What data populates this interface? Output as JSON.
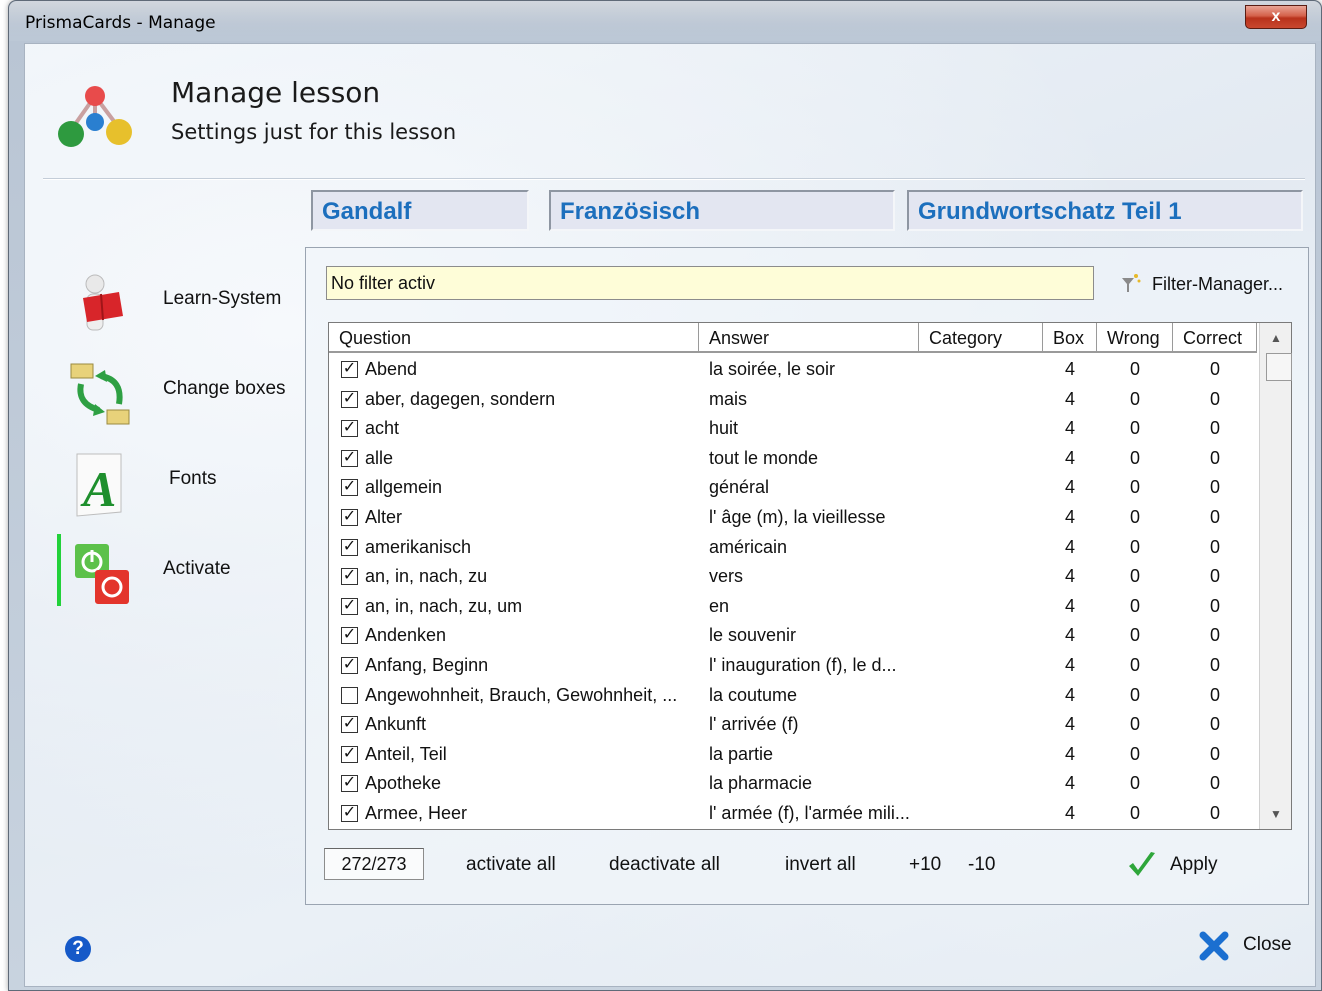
{
  "window": {
    "title": "PrismaCards - Manage",
    "close_glyph": "x"
  },
  "header": {
    "title": "Manage lesson",
    "subtitle": "Settings just for this lesson"
  },
  "info": {
    "user": "Gandalf",
    "language": "Französisch",
    "lesson": "Grundwortschatz Teil 1"
  },
  "sidebar": {
    "items": [
      {
        "label": "Learn-System",
        "icon": "learn-system-icon"
      },
      {
        "label": "Change boxes",
        "icon": "change-boxes-icon"
      },
      {
        "label": "Fonts",
        "icon": "fonts-icon"
      },
      {
        "label": "Activate",
        "icon": "activate-icon",
        "active": true
      }
    ]
  },
  "filter": {
    "value": "No filter activ",
    "manager_label": "Filter-Manager..."
  },
  "grid": {
    "columns": [
      "Question",
      "Answer",
      "Category",
      "Box",
      "Wrong",
      "Correct"
    ],
    "rows": [
      {
        "checked": true,
        "question": "Abend",
        "answer": "la soirée, le soir",
        "category": "",
        "box": "4",
        "wrong": "0",
        "correct": "0"
      },
      {
        "checked": true,
        "question": "aber, dagegen, sondern",
        "answer": "mais",
        "category": "",
        "box": "4",
        "wrong": "0",
        "correct": "0"
      },
      {
        "checked": true,
        "question": "acht",
        "answer": "huit",
        "category": "",
        "box": "4",
        "wrong": "0",
        "correct": "0"
      },
      {
        "checked": true,
        "question": "alle",
        "answer": "tout le monde",
        "category": "",
        "box": "4",
        "wrong": "0",
        "correct": "0"
      },
      {
        "checked": true,
        "question": "allgemein",
        "answer": "général",
        "category": "",
        "box": "4",
        "wrong": "0",
        "correct": "0"
      },
      {
        "checked": true,
        "question": "Alter",
        "answer": "l' âge (m), la vieillesse",
        "category": "",
        "box": "4",
        "wrong": "0",
        "correct": "0"
      },
      {
        "checked": true,
        "question": "amerikanisch",
        "answer": "américain",
        "category": "",
        "box": "4",
        "wrong": "0",
        "correct": "0"
      },
      {
        "checked": true,
        "question": "an, in, nach, zu",
        "answer": "vers",
        "category": "",
        "box": "4",
        "wrong": "0",
        "correct": "0"
      },
      {
        "checked": true,
        "question": "an, in, nach, zu, um",
        "answer": "en",
        "category": "",
        "box": "4",
        "wrong": "0",
        "correct": "0"
      },
      {
        "checked": true,
        "question": "Andenken",
        "answer": "le souvenir",
        "category": "",
        "box": "4",
        "wrong": "0",
        "correct": "0"
      },
      {
        "checked": true,
        "question": "Anfang, Beginn",
        "answer": "l' inauguration (f), le d...",
        "category": "",
        "box": "4",
        "wrong": "0",
        "correct": "0"
      },
      {
        "checked": false,
        "question": "Angewohnheit, Brauch, Gewohnheit, ...",
        "answer": "la coutume",
        "category": "",
        "box": "4",
        "wrong": "0",
        "correct": "0"
      },
      {
        "checked": true,
        "question": "Ankunft",
        "answer": "l' arrivée (f)",
        "category": "",
        "box": "4",
        "wrong": "0",
        "correct": "0"
      },
      {
        "checked": true,
        "question": "Anteil, Teil",
        "answer": "la partie",
        "category": "",
        "box": "4",
        "wrong": "0",
        "correct": "0"
      },
      {
        "checked": true,
        "question": "Apotheke",
        "answer": "la pharmacie",
        "category": "",
        "box": "4",
        "wrong": "0",
        "correct": "0"
      },
      {
        "checked": true,
        "question": "Armee, Heer",
        "answer": "l' armée (f), l'armée mili...",
        "category": "",
        "box": "4",
        "wrong": "0",
        "correct": "0"
      }
    ]
  },
  "footer": {
    "count": "272/273",
    "activate_all": "activate all",
    "deactivate_all": "deactivate all",
    "invert_all": "invert all",
    "plus10": "+10",
    "minus10": "-10",
    "apply": "Apply"
  },
  "bottom": {
    "help": "?",
    "close": "Close"
  },
  "colors": {
    "accent": "#1c6fbd",
    "active_bar": "#22d13a",
    "filter_bg": "#fefdd8"
  }
}
